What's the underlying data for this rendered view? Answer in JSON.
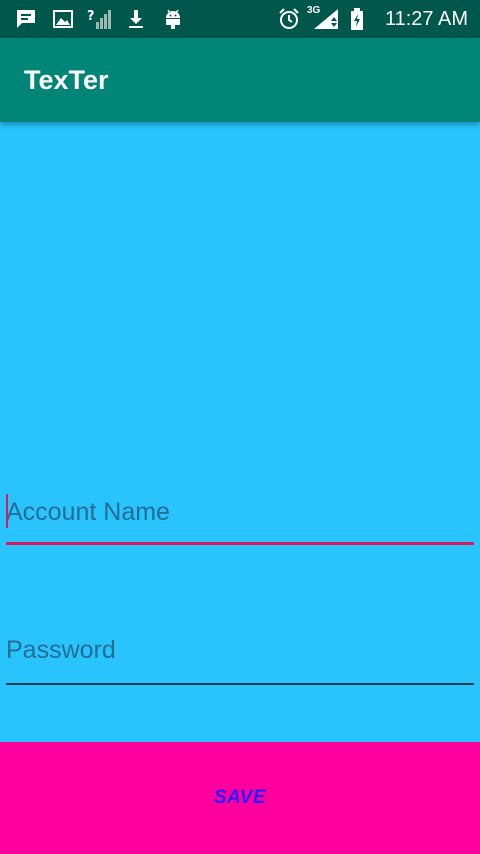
{
  "status_bar": {
    "time": "11:27 AM",
    "network_label": "3G",
    "left_icons": [
      "message-icon",
      "image-icon",
      "no-signal-icon",
      "download-icon",
      "android-icon"
    ],
    "right_icons": [
      "alarm-icon",
      "signal-icon",
      "battery-charging-icon"
    ]
  },
  "app_bar": {
    "title": "TexTer"
  },
  "form": {
    "account_placeholder": "Account Name",
    "password_placeholder": "Password",
    "save_label": "SAVE"
  },
  "colors": {
    "status_bar": "#00574b",
    "app_bar": "#008577",
    "background": "#29c3fe",
    "accent": "#d81b60",
    "save_button": "#ff009e",
    "save_text": "#2a1bff"
  }
}
